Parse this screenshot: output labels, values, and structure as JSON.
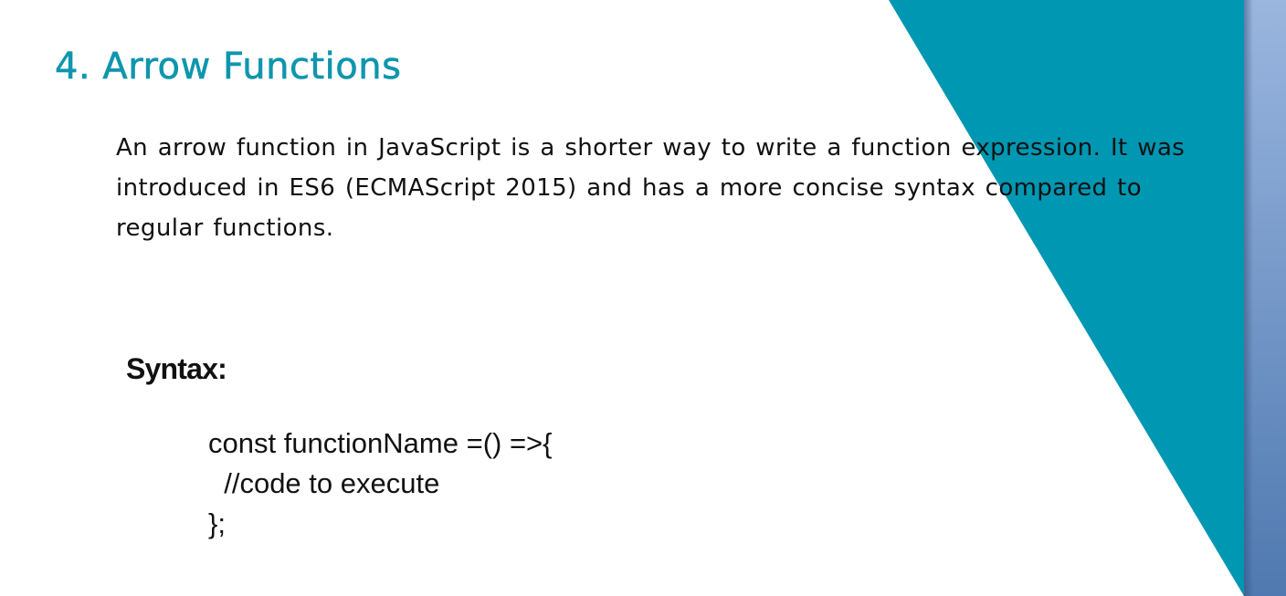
{
  "slide": {
    "title": "4. Arrow Functions",
    "description": "An arrow function in JavaScript is a shorter way to write a function expression. It was introduced in ES6 (ECMAScript 2015) and has a more concise syntax compared to regular functions.",
    "syntax_heading": "Syntax:",
    "code_lines": [
      "const functionName =() =>{",
      "  //code to execute",
      "};"
    ]
  },
  "colors": {
    "accent_teal": "#0097b2",
    "title_color": "#0e96ad",
    "side_bar_top": "#9ab6df",
    "side_bar_bottom": "#4f79b0",
    "text_color": "#111111"
  }
}
